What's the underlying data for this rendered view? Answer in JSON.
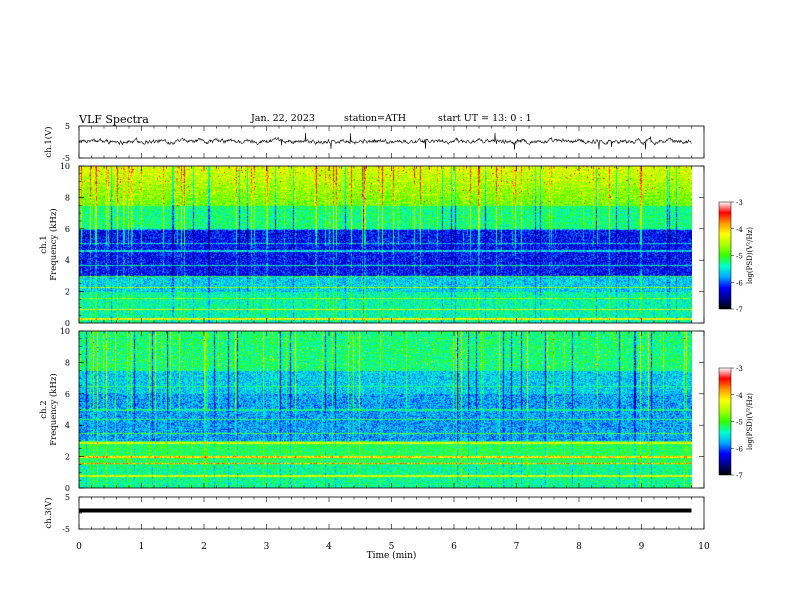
{
  "header": {
    "title": "VLF  Spectra",
    "date": "Jan. 22, 2023",
    "station": "station=ATH",
    "start_ut": "start  UT  =    13: 0   : 1"
  },
  "colors": {
    "waveform": "#000000",
    "colormap": [
      "#000000",
      "#00008b",
      "#0000ff",
      "#00aaff",
      "#00ffcc",
      "#33ff00",
      "#aaff00",
      "#ffff00",
      "#ff9900",
      "#ff0000",
      "#ffffff"
    ]
  },
  "chart_data": [
    {
      "type": "line",
      "name": "ch1",
      "ylabel": "ch.1(V)",
      "ylim": [
        -5,
        5
      ],
      "yticks": [
        "5",
        "-5"
      ],
      "xlim": [
        0,
        10
      ],
      "x_data_end": 9.8,
      "baseline": 0.2,
      "noise_amplitude": 1.0
    },
    {
      "type": "heatmap",
      "name": "ch1-spectrogram",
      "ylabel_lines": [
        "ch.1",
        "Frequency  (kHz)"
      ],
      "ylim": [
        0,
        10
      ],
      "yticks": [
        "0",
        "2",
        "4",
        "6",
        "8",
        "10"
      ],
      "xlim": [
        0,
        10
      ],
      "x_data_end": 9.8,
      "colorbar": {
        "label": "log(PSD)(V²/Hz)",
        "range": [
          -7,
          -3
        ],
        "ticks": [
          "-3",
          "-4",
          "-5",
          "-6",
          "-7"
        ]
      }
    },
    {
      "type": "heatmap",
      "name": "ch2-spectrogram",
      "ylabel_lines": [
        "ch.2",
        "Frequency  (kHz)"
      ],
      "ylim": [
        0,
        10
      ],
      "yticks": [
        "0",
        "2",
        "4",
        "6",
        "8",
        "10"
      ],
      "xlim": [
        0,
        10
      ],
      "x_data_end": 9.8,
      "colorbar": {
        "label": "log(PSD)(V²/Hz)",
        "range": [
          -7,
          -3
        ],
        "ticks": [
          "-3",
          "-4",
          "-5",
          "-6",
          "-7"
        ]
      }
    },
    {
      "type": "line",
      "name": "ch3",
      "ylabel": "ch.3(V)",
      "ylim": [
        -5,
        5
      ],
      "yticks": [
        "5",
        "-5"
      ],
      "xlim": [
        0,
        10
      ],
      "x_data_end": 9.8,
      "baseline": 0.8,
      "noise_amplitude": 0
    }
  ],
  "xaxis": {
    "label": "Time  (min)",
    "ticks": [
      "0",
      "1",
      "2",
      "3",
      "4",
      "5",
      "6",
      "7",
      "8",
      "9",
      "10"
    ]
  }
}
